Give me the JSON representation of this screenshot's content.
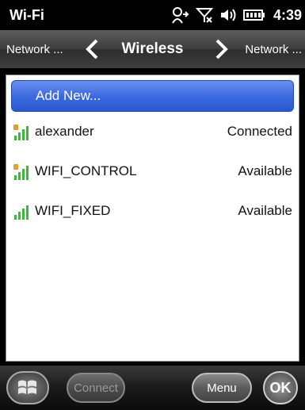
{
  "status_bar": {
    "title": "Wi-Fi",
    "time": "4:39"
  },
  "nav": {
    "left_label": "Network ...",
    "title": "Wireless",
    "right_label": "Network ..."
  },
  "list": {
    "add_new_label": "Add New...",
    "networks": [
      {
        "ssid": "alexander",
        "status": "Connected",
        "secured": true,
        "signal_bars": 4
      },
      {
        "ssid": "WIFI_CONTROL",
        "status": "Available",
        "secured": true,
        "signal_bars": 4
      },
      {
        "ssid": "WIFI_FIXED",
        "status": "Available",
        "secured": false,
        "signal_bars": 4
      }
    ]
  },
  "softkeys": {
    "connect_label": "Connect",
    "menu_label": "Menu",
    "ok_label": "OK"
  },
  "icons": {
    "start": "windows-start-icon",
    "sync": "sync-icon",
    "no_signal": "no-signal-icon",
    "volume": "volume-icon",
    "battery": "battery-icon",
    "nav_prev": "chevron-left-icon",
    "nav_next": "chevron-right-icon",
    "signal": "wifi-signal-icon",
    "lock": "lock-icon"
  },
  "colors": {
    "accent": "#3d6be0",
    "signal_green": "#3cb83c",
    "lock_orange": "#e0a030"
  }
}
